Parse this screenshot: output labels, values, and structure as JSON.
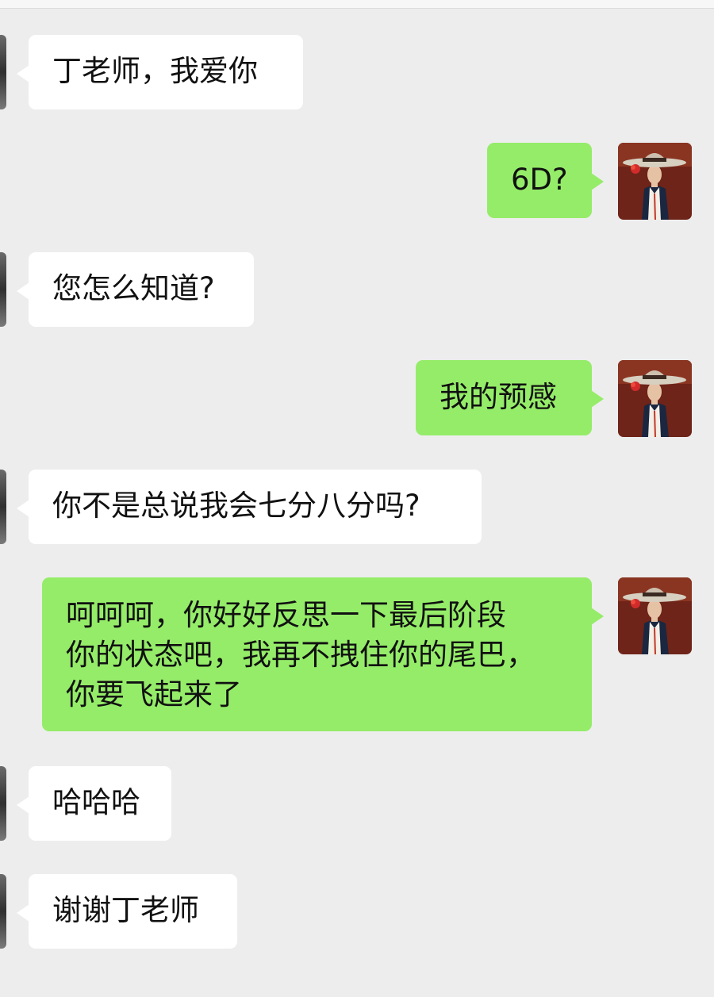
{
  "messages": [
    {
      "side": "in",
      "text": "丁老师，我爱你"
    },
    {
      "side": "out",
      "text": "6D?"
    },
    {
      "side": "in",
      "text": "您怎么知道?"
    },
    {
      "side": "out",
      "text": "我的预感"
    },
    {
      "side": "in",
      "text": "你不是总说我会七分八分吗?"
    },
    {
      "side": "out",
      "lines": [
        "呵呵呵，你好好反思一下最后阶段",
        "你的状态吧，我再不拽住你的尾巴，",
        "你要飞起来了"
      ]
    },
    {
      "side": "in",
      "text": "哈哈哈"
    },
    {
      "side": "in",
      "text": "谢谢丁老师"
    }
  ],
  "colors": {
    "background": "#ededed",
    "incoming_bubble": "#ffffff",
    "outgoing_bubble": "#95ec69"
  },
  "icons": {
    "peer_avatar": "peer-avatar-icon",
    "self_avatar": "self-avatar-icon"
  }
}
